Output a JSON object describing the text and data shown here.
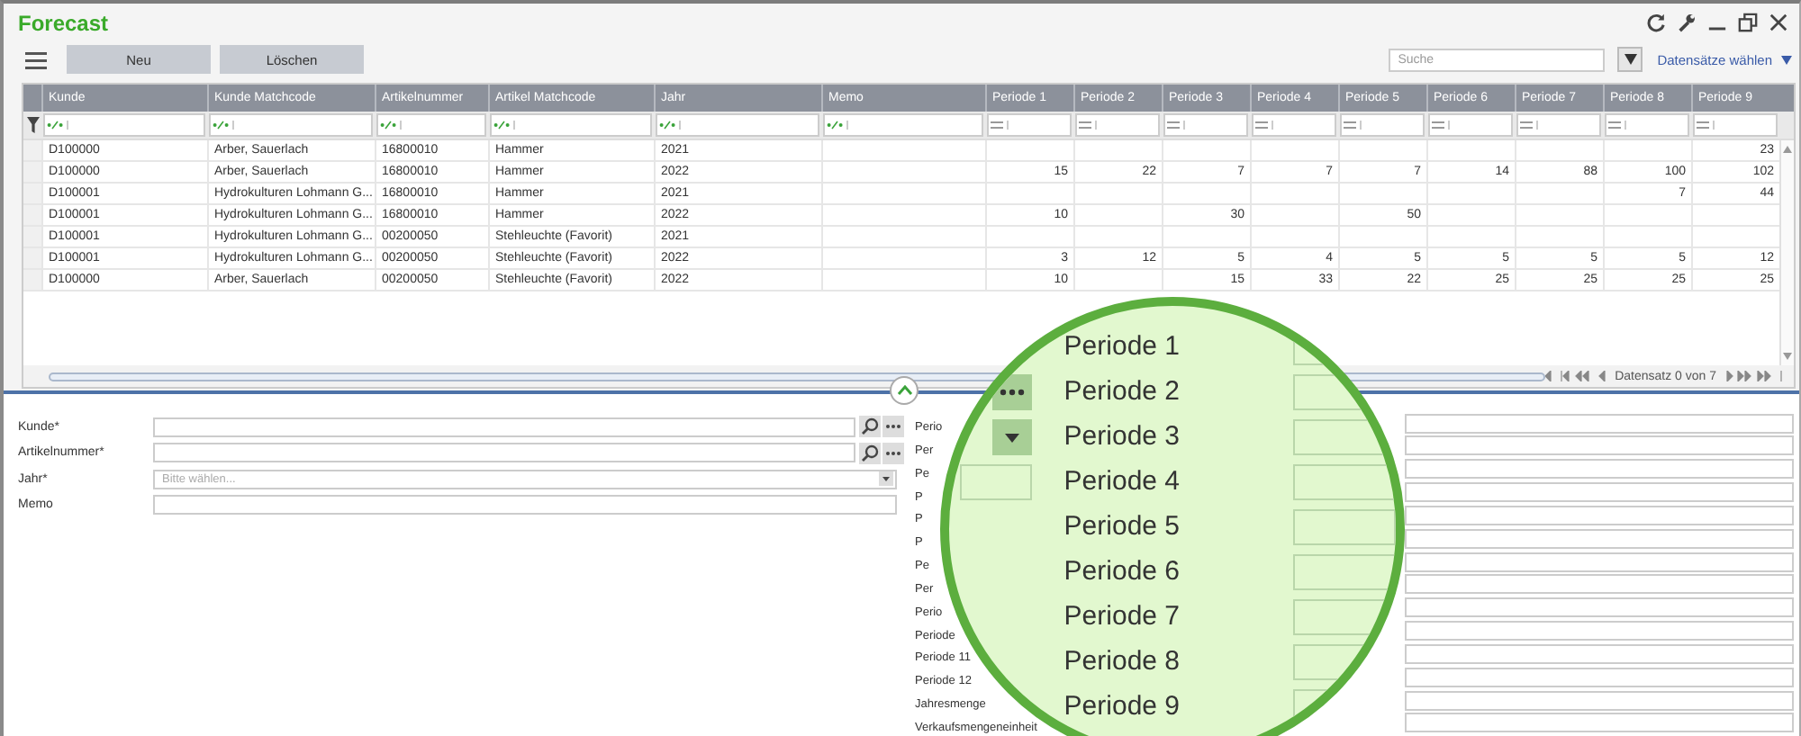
{
  "window": {
    "title": "Forecast"
  },
  "toolbar": {
    "buttons": [
      "Neu",
      "Löschen"
    ],
    "search": {
      "placeholder": "Suche"
    },
    "record_select": "Datensätze wählen"
  },
  "table": {
    "columns": [
      {
        "label": "Kunde",
        "kind": "text"
      },
      {
        "label": "Kunde Matchcode",
        "kind": "text"
      },
      {
        "label": "Artikelnummer",
        "kind": "text"
      },
      {
        "label": "Artikel Matchcode",
        "kind": "text"
      },
      {
        "label": "Jahr",
        "kind": "text"
      },
      {
        "label": "Memo",
        "kind": "text"
      },
      {
        "label": "Periode 1",
        "kind": "number"
      },
      {
        "label": "Periode 2",
        "kind": "number"
      },
      {
        "label": "Periode 3",
        "kind": "number"
      },
      {
        "label": "Periode 4",
        "kind": "number"
      },
      {
        "label": "Periode 5",
        "kind": "number"
      },
      {
        "label": "Periode 6",
        "kind": "number"
      },
      {
        "label": "Periode 7",
        "kind": "number"
      },
      {
        "label": "Periode 8",
        "kind": "number"
      },
      {
        "label": "Periode 9",
        "kind": "number"
      }
    ],
    "rows": [
      [
        "D100000",
        "Arber, Sauerlach",
        "16800010",
        "Hammer",
        "2021",
        null,
        null,
        null,
        null,
        null,
        null,
        null,
        null,
        null,
        "23"
      ],
      [
        "D100000",
        "Arber, Sauerlach",
        "16800010",
        "Hammer",
        "2022",
        null,
        "15",
        "22",
        "7",
        "7",
        "7",
        "14",
        "88",
        "100",
        "102"
      ],
      [
        "D100001",
        "Hydrokulturen Lohmann G...",
        "16800010",
        "Hammer",
        "2021",
        null,
        null,
        null,
        null,
        null,
        null,
        null,
        null,
        "7",
        "44"
      ],
      [
        "D100001",
        "Hydrokulturen Lohmann G...",
        "16800010",
        "Hammer",
        "2022",
        null,
        "10",
        null,
        "30",
        null,
        "50",
        null,
        null,
        null,
        null
      ],
      [
        "D100001",
        "Hydrokulturen Lohmann G...",
        "00200050",
        "Stehleuchte  (Favorit)",
        "2021",
        null,
        null,
        null,
        null,
        null,
        null,
        null,
        null,
        null,
        null
      ],
      [
        "D100001",
        "Hydrokulturen Lohmann G...",
        "00200050",
        "Stehleuchte  (Favorit)",
        "2022",
        null,
        "3",
        "12",
        "5",
        "4",
        "5",
        "5",
        "5",
        "5",
        "12"
      ],
      [
        "D100000",
        "Arber, Sauerlach",
        "00200050",
        "Stehleuchte  (Favorit)",
        "2022",
        null,
        "10",
        null,
        "15",
        "33",
        "22",
        "25",
        "25",
        "25",
        "25"
      ]
    ]
  },
  "pager": "Datensatz 0 von 7",
  "form_left": [
    {
      "label": "Kunde*",
      "kind": "lookup"
    },
    {
      "label": "Artikelnummer*",
      "kind": "lookup"
    },
    {
      "label": "Jahr*",
      "kind": "select",
      "placeholder": "Bitte wählen..."
    },
    {
      "label": "Memo",
      "kind": "text"
    }
  ],
  "form_right": {
    "labels": [
      "Perio",
      "Per",
      "Pe",
      "P",
      "P",
      "P",
      "Pe",
      "Per",
      "Perio",
      "Periode",
      "Periode 11",
      "Periode 12",
      "Jahresmenge",
      "Verkaufsmengeneinheit"
    ]
  },
  "magnifier": {
    "labels": [
      "Periode 1",
      "Periode 2",
      "Periode 3",
      "Periode 4",
      "Periode 5",
      "Periode 6",
      "Periode 7",
      "Periode 8",
      "Periode 9"
    ]
  }
}
